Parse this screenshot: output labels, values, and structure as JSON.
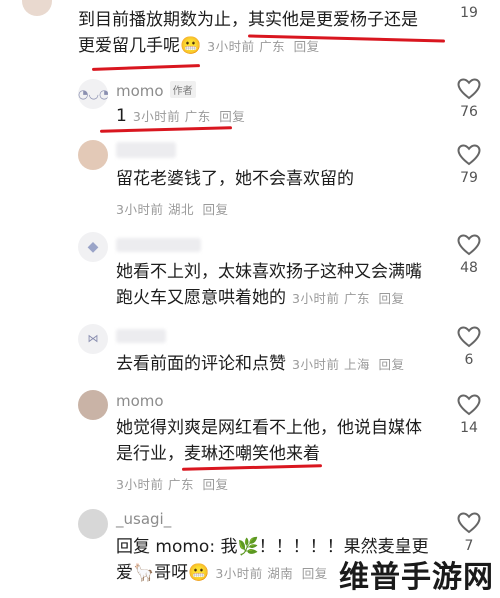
{
  "comments": [
    {
      "username": "",
      "text_lines": [
        "到目前播放期数为止，其实他是更爱杨子还是",
        "更爱留几手呢"
      ],
      "emoji": "😬",
      "time": "3小时前",
      "location": "广东",
      "reply_label": "回复",
      "likes": "19"
    },
    {
      "username": "momo",
      "badge": "作者",
      "text_lines": [
        "1"
      ],
      "time": "3小时前",
      "location": "广东",
      "reply_label": "回复",
      "likes": "76"
    },
    {
      "username": "",
      "text_lines": [
        "留花老婆钱了，她不会喜欢留的"
      ],
      "time": "3小时前",
      "location": "湖北",
      "reply_label": "回复",
      "likes": "79"
    },
    {
      "username": "",
      "text_lines": [
        "她看不上刘，太妹喜欢扬子这种又会满嘴",
        "跑火车又愿意哄着她的"
      ],
      "time": "3小时前",
      "location": "广东",
      "reply_label": "回复",
      "likes": "48"
    },
    {
      "username": "",
      "text_lines": [
        "去看前面的评论和点赞"
      ],
      "time": "3小时前",
      "location": "上海",
      "reply_label": "回复",
      "likes": "6"
    },
    {
      "username": "momo",
      "text_lines": [
        "她觉得刘爽是网红看不上他，他说自媒体",
        "是行业，麦琳还嘲笑他来着"
      ],
      "time": "3小时前",
      "location": "广东",
      "reply_label": "回复",
      "likes": "14"
    },
    {
      "username": "_usagi_",
      "text_lines": [
        "回复 momo: 我🌿！！！！！果然麦皇更",
        "爱🦙哥呀😬"
      ],
      "time": "3小时前",
      "location": "湖南",
      "reply_label": "回复",
      "likes": "7"
    }
  ],
  "icons": {
    "like": "heart-outline-icon"
  },
  "colors": {
    "highlight_underline": "#d9161f",
    "meta_text": "#9a9a9a"
  },
  "watermark": "维普手游网"
}
